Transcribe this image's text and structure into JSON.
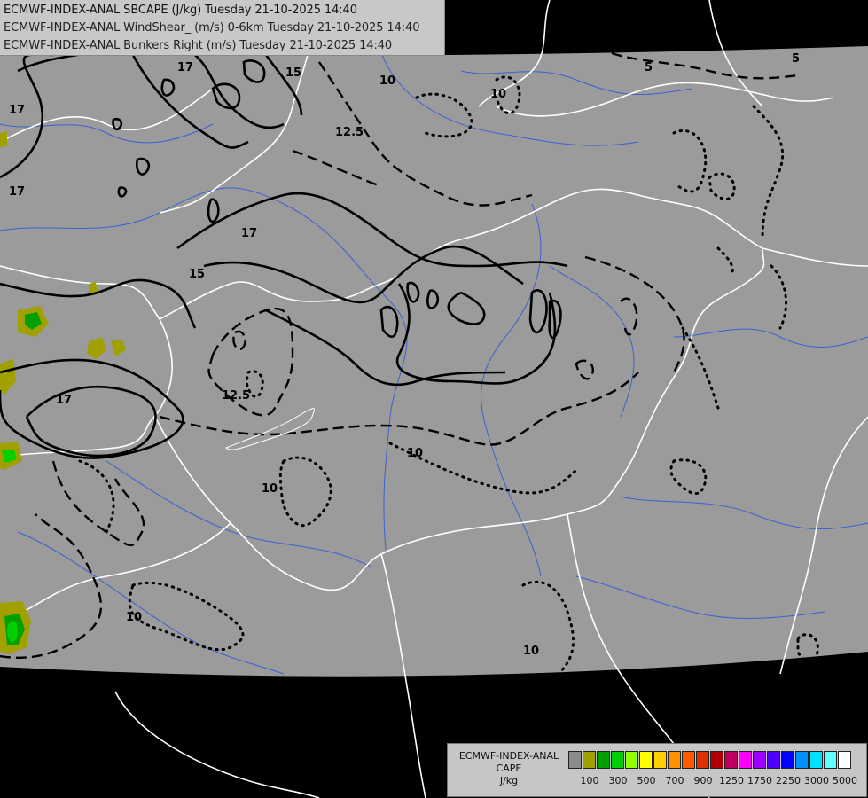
{
  "titles": {
    "line1": "ECMWF-INDEX-ANAL SBCAPE (J/kg) Tuesday 21-10-2025 14:40",
    "line2": "ECMWF-INDEX-ANAL WindShear_ (m/s) 0-6km Tuesday 21-10-2025 14:40",
    "line3": "ECMWF-INDEX-ANAL Bunkers Right (m/s) Tuesday 21-10-2025 14:40"
  },
  "contour_labels": {
    "l17a": "17",
    "l17b": "17",
    "l17c": "17",
    "l17d": "17",
    "l17e": "17",
    "l15a": "15",
    "l15b": "15",
    "l125a": "12.5",
    "l125b": "12.5",
    "l10a": "10",
    "l10b": "10",
    "l10c": "10",
    "l10d": "10",
    "l10e": "10",
    "l10f": "10",
    "l5a": "5",
    "l5b": "5"
  },
  "legend": {
    "title": "ECMWF-INDEX-ANAL",
    "subtitle": "CAPE",
    "unit": "J/kg",
    "colors": [
      "#8c8c8c",
      "#a0a000",
      "#00a000",
      "#00d000",
      "#90ff00",
      "#ffff00",
      "#ffd000",
      "#ff9000",
      "#ff5a00",
      "#e03000",
      "#b00000",
      "#c00060",
      "#ff00ff",
      "#a000ff",
      "#5000ff",
      "#0000ff",
      "#0090ff",
      "#00e0ff",
      "#60ffff",
      "#ffffff"
    ],
    "tick_labels": [
      "100",
      "300",
      "500",
      "700",
      "900",
      "1250",
      "1750",
      "2250",
      "3000",
      "5000"
    ]
  },
  "colors": {
    "background": "#000000",
    "map_fill": "#9b9b9b",
    "border": "#ffffff",
    "river": "#2f5bd6",
    "contour": "#000000"
  }
}
